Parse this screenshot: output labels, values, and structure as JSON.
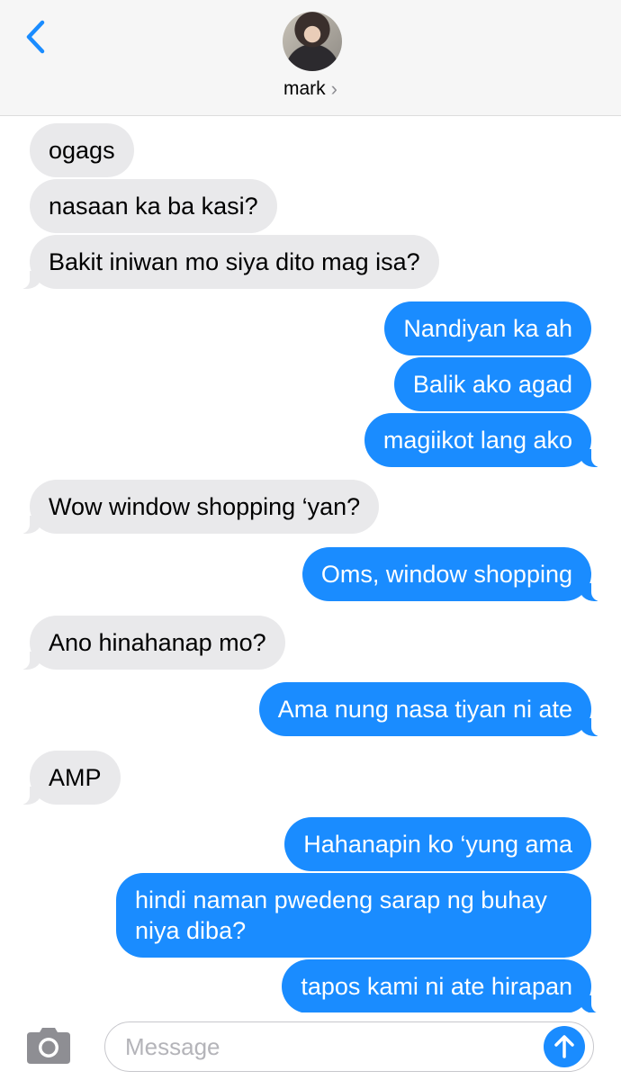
{
  "header": {
    "contact_name": "mark",
    "back_icon": "chevron-left-icon",
    "contact_chevron": "›"
  },
  "messages": [
    {
      "from": "in",
      "text": "ogags"
    },
    {
      "from": "in",
      "text": "nasaan ka ba kasi?"
    },
    {
      "from": "in",
      "text": "Bakit iniwan mo siya dito mag isa?"
    },
    {
      "from": "out",
      "text": "Nandiyan ka ah"
    },
    {
      "from": "out",
      "text": "Balik ako agad"
    },
    {
      "from": "out",
      "text": "magiikot lang ako"
    },
    {
      "from": "in",
      "text": "Wow window shopping ‘yan?"
    },
    {
      "from": "out",
      "text": "Oms, window shopping"
    },
    {
      "from": "in",
      "text": "Ano hinahanap mo?"
    },
    {
      "from": "out",
      "text": "Ama nung nasa tiyan ni ate"
    },
    {
      "from": "in",
      "text": "AMP"
    },
    {
      "from": "out",
      "text": "Hahanapin ko ‘yung ama"
    },
    {
      "from": "out",
      "text": "hindi naman pwedeng sarap ng buhay niya diba?"
    },
    {
      "from": "out",
      "text": "tapos kami ni ate hirapan"
    }
  ],
  "composer": {
    "placeholder": "Message",
    "camera_icon": "camera-icon",
    "send_icon": "arrow-up-icon"
  },
  "colors": {
    "accent": "#1a8cff",
    "incoming_bubble": "#e9e9eb",
    "header_bg": "#f6f6f6"
  }
}
